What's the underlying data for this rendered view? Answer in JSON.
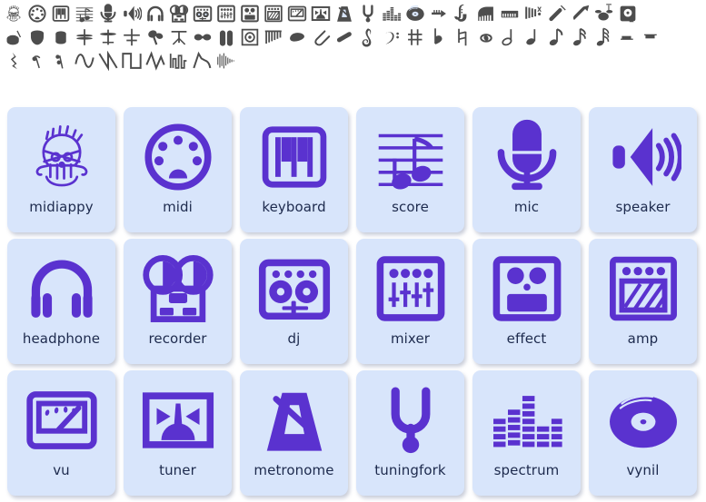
{
  "palette": {
    "page_background": "#ffffff",
    "card_background": "#d8e5fb",
    "icon_purple": "#5a32cf",
    "label_text": "#1d2a4d",
    "glyph_gray": "#4d4d4d"
  },
  "glyph_strip": {
    "rows": [
      [
        {
          "name": "midiappy-icon"
        },
        {
          "name": "midi-icon"
        },
        {
          "name": "keyboard-icon"
        },
        {
          "name": "score-icon"
        },
        {
          "name": "mic-icon"
        },
        {
          "name": "speaker-icon"
        },
        {
          "name": "headphone-icon"
        },
        {
          "name": "recorder-icon"
        },
        {
          "name": "dj-icon"
        },
        {
          "name": "mixer-icon"
        },
        {
          "name": "effect-icon"
        },
        {
          "name": "amp-icon"
        },
        {
          "name": "vu-icon"
        },
        {
          "name": "tuner-icon"
        },
        {
          "name": "metronome-icon"
        },
        {
          "name": "tuningfork-icon"
        },
        {
          "name": "spectrum-icon"
        },
        {
          "name": "vynil-icon"
        },
        {
          "name": "trumpet-icon"
        },
        {
          "name": "saxophone-icon"
        },
        {
          "name": "piano-icon"
        },
        {
          "name": "synth-icon"
        },
        {
          "name": "xylophone-icon"
        },
        {
          "name": "violin-icon"
        },
        {
          "name": "guitar-icon"
        },
        {
          "name": "drumkit-icon"
        },
        {
          "name": "speakercab-icon"
        }
      ],
      [
        {
          "name": "snare-icon"
        },
        {
          "name": "timpani-icon"
        },
        {
          "name": "bongo-icon"
        },
        {
          "name": "hihat-icon"
        },
        {
          "name": "cymbal-icon"
        },
        {
          "name": "crash-icon"
        },
        {
          "name": "maracas-icon"
        },
        {
          "name": "drumstand-icon"
        },
        {
          "name": "castanet-icon"
        },
        {
          "name": "congas-icon"
        },
        {
          "name": "gong-icon"
        },
        {
          "name": "panflute-icon"
        },
        {
          "name": "pick-icon"
        },
        {
          "name": "clip-icon"
        },
        {
          "name": "capo-icon"
        },
        {
          "name": "treble-clef-icon"
        },
        {
          "name": "bass-clef-icon"
        },
        {
          "name": "sharp-icon"
        },
        {
          "name": "flat-icon"
        },
        {
          "name": "natural-icon"
        },
        {
          "name": "whole-note-icon"
        },
        {
          "name": "half-note-icon"
        },
        {
          "name": "quarter-note-icon"
        },
        {
          "name": "eighth-note-icon"
        },
        {
          "name": "sixteenth-note-icon"
        },
        {
          "name": "thirtysecond-note-icon"
        },
        {
          "name": "whole-rest-icon"
        },
        {
          "name": "half-rest-icon"
        }
      ],
      [
        {
          "name": "quarter-rest-icon"
        },
        {
          "name": "eighth-rest-icon"
        },
        {
          "name": "sixteenth-rest-icon"
        },
        {
          "name": "sine-wave-icon"
        },
        {
          "name": "sawtooth-wave-icon"
        },
        {
          "name": "square-wave-icon"
        },
        {
          "name": "triangle-wave-icon"
        },
        {
          "name": "pulse-wave-icon"
        },
        {
          "name": "envelope-icon"
        },
        {
          "name": "waveform-icon"
        }
      ]
    ]
  },
  "cards": [
    {
      "label": "midiappy",
      "icon": "midiappy-icon"
    },
    {
      "label": "midi",
      "icon": "midi-icon"
    },
    {
      "label": "keyboard",
      "icon": "keyboard-icon"
    },
    {
      "label": "score",
      "icon": "score-icon"
    },
    {
      "label": "mic",
      "icon": "mic-icon"
    },
    {
      "label": "speaker",
      "icon": "speaker-icon"
    },
    {
      "label": "headphone",
      "icon": "headphone-icon"
    },
    {
      "label": "recorder",
      "icon": "recorder-icon"
    },
    {
      "label": "dj",
      "icon": "dj-icon"
    },
    {
      "label": "mixer",
      "icon": "mixer-icon"
    },
    {
      "label": "effect",
      "icon": "effect-icon"
    },
    {
      "label": "amp",
      "icon": "amp-icon"
    },
    {
      "label": "vu",
      "icon": "vu-icon"
    },
    {
      "label": "tuner",
      "icon": "tuner-icon"
    },
    {
      "label": "metronome",
      "icon": "metronome-icon"
    },
    {
      "label": "tuningfork",
      "icon": "tuningfork-icon"
    },
    {
      "label": "spectrum",
      "icon": "spectrum-icon"
    },
    {
      "label": "vynil",
      "icon": "vynil-icon"
    }
  ]
}
